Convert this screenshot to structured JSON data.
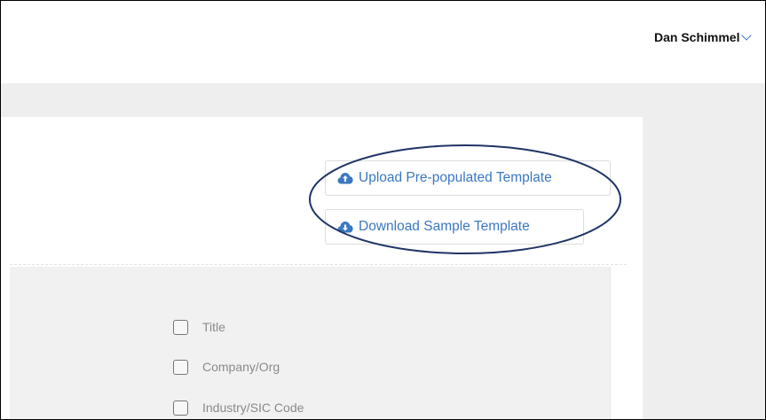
{
  "header": {
    "user_name": "Dan Schimmel",
    "user_menu_icon": "chevron-down-icon"
  },
  "actions": {
    "upload_label": "Upload Pre-populated Template",
    "upload_icon": "cloud-upload-icon",
    "download_label": "Download Sample Template",
    "download_icon": "cloud-download-icon"
  },
  "fields": {
    "items": [
      {
        "label": "Title",
        "checked": false
      },
      {
        "label": "Company/Org",
        "checked": false
      },
      {
        "label": "Industry/SIC Code",
        "checked": false
      }
    ]
  },
  "colors": {
    "accent": "#3a78c2",
    "annotation": "#1f3466",
    "background": "#eeeeee"
  }
}
